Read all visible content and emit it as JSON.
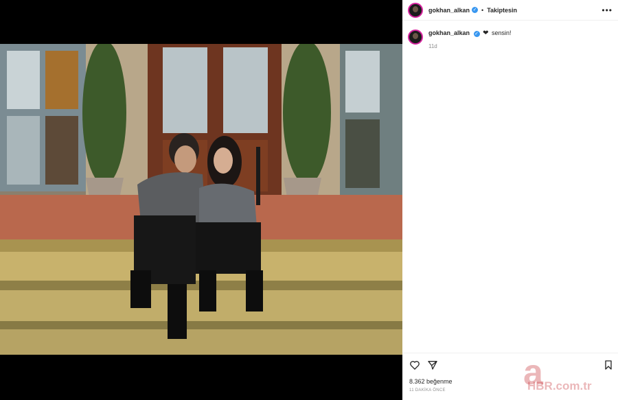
{
  "post": {
    "username": "gokhan_alkan",
    "verified_icon": "verified-badge-icon",
    "separator": "•",
    "follow_status": "Takiptesin",
    "more_icon": "more-options-icon",
    "more_label": "•••"
  },
  "caption": {
    "username": "gokhan_alkan",
    "text": "sensin!",
    "time": "11d"
  },
  "actions": {
    "like_icon": "heart-icon",
    "share_icon": "send-icon",
    "save_icon": "bookmark-icon"
  },
  "stats": {
    "likes": "8.362 beğenme",
    "posted_ago": "11 DAKİKA ÖNCE"
  },
  "watermark": {
    "brand": "a",
    "text": "HBR.com.tr"
  },
  "colors": {
    "verified": "#3897f0",
    "story_ring": "#d6249f",
    "watermark": "#c8343a"
  }
}
